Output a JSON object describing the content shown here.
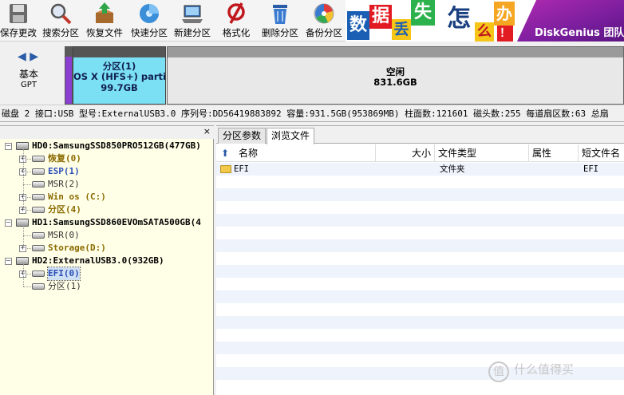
{
  "toolbar": {
    "buttons": [
      {
        "label": "保存更改",
        "icon": "save-changes-icon"
      },
      {
        "label": "搜索分区",
        "icon": "search-partition-icon"
      },
      {
        "label": "恢复文件",
        "icon": "recover-files-icon"
      },
      {
        "label": "快速分区",
        "icon": "quick-partition-icon"
      },
      {
        "label": "新建分区",
        "icon": "new-partition-icon"
      },
      {
        "label": "格式化",
        "icon": "format-icon"
      },
      {
        "label": "删除分区",
        "icon": "delete-partition-icon"
      },
      {
        "label": "备份分区",
        "icon": "backup-partition-icon"
      }
    ]
  },
  "banner": {
    "chars": [
      "数",
      "据",
      "丢",
      "失",
      "怎",
      "么",
      "办",
      "！"
    ],
    "brand": "DiskGenius 团队"
  },
  "disk_map": {
    "disk_type": "基本",
    "partition_style": "GPT",
    "partition1": {
      "name": "分区(1)",
      "fs": "OS X (HFS+) parti",
      "size": "99.7GB"
    },
    "free": {
      "label": "空闲",
      "size": "831.6GB"
    }
  },
  "disk_info": "磁盘 2 接口:USB  型号:ExternalUSB3.0  序列号:DD56419883892  容量:931.5GB(953869MB)  柱面数:121601  磁头数:255  每道扇区数:63  总扇",
  "tree": {
    "close": "×",
    "items": [
      {
        "text": "HD0:SamsungSSD850PRO512GB(477GB)",
        "level": 0,
        "expander": "−",
        "color": "#000000",
        "kind": "disk"
      },
      {
        "text": "恢复(0)",
        "level": 1,
        "expander": "+",
        "color": "#8a6a00",
        "kind": "part"
      },
      {
        "text": "ESP(1)",
        "level": 1,
        "expander": "+",
        "color": "#2a4db5",
        "kind": "part"
      },
      {
        "text": "MSR(2)",
        "level": 1,
        "expander": "",
        "color": "#333333",
        "kind": "part"
      },
      {
        "text": "Win os (C:)",
        "level": 1,
        "expander": "+",
        "color": "#8a6a00",
        "kind": "part"
      },
      {
        "text": "分区(4)",
        "level": 1,
        "expander": "+",
        "color": "#8a6a00",
        "kind": "part"
      },
      {
        "text": "HD1:SamsungSSD860EVOmSATA500GB(4",
        "level": 0,
        "expander": "−",
        "color": "#000000",
        "kind": "disk"
      },
      {
        "text": "MSR(0)",
        "level": 1,
        "expander": "",
        "color": "#333333",
        "kind": "part"
      },
      {
        "text": "Storage(D:)",
        "level": 1,
        "expander": "+",
        "color": "#8a6a00",
        "kind": "part"
      },
      {
        "text": "HD2:ExternalUSB3.0(932GB)",
        "level": 0,
        "expander": "−",
        "color": "#000000",
        "kind": "disk"
      },
      {
        "text": "EFI(0)",
        "level": 1,
        "expander": "+",
        "color": "#2a4db5",
        "kind": "part",
        "selected": true
      },
      {
        "text": "分区(1)",
        "level": 1,
        "expander": "",
        "color": "#333333",
        "kind": "part"
      }
    ]
  },
  "tabs": [
    {
      "label": "分区参数",
      "active": false
    },
    {
      "label": "浏览文件",
      "active": true
    }
  ],
  "file_table": {
    "columns": [
      "名称",
      "大小",
      "文件类型",
      "属性",
      "短文件名"
    ],
    "rows": [
      {
        "name": "EFI",
        "size": "",
        "type": "文件夹",
        "attr": "",
        "short": "EFI"
      }
    ]
  },
  "watermark": "值 什么值得买"
}
